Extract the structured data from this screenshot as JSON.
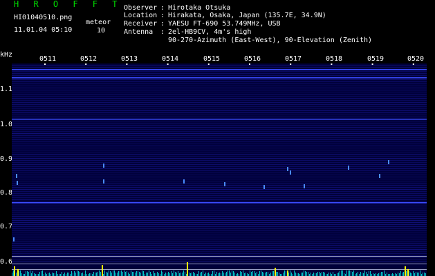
{
  "header": {
    "app_title": "H R O F F T",
    "file_name": "HI01040510.png",
    "time_stamp": "11.01.04 05:10",
    "meteor_label": "meteor",
    "meteor_count": "10"
  },
  "info": [
    {
      "key": "Observer",
      "value": "Hirotaka Otsuka"
    },
    {
      "key": "Location",
      "value": "Hirakata, Osaka, Japan (135.7E, 34.9N)"
    },
    {
      "key": "Receiver",
      "value": "YAESU FT-690 53.749MHz, USB"
    },
    {
      "key": "Antenna",
      "value": "2el-HB9CV, 4m's high"
    },
    {
      "key": "",
      "value": "90-270-Azimuth (East-West), 90-Elevation (Zenith)"
    }
  ],
  "separator": ":",
  "spectrogram": {
    "y_unit_label": "kHz",
    "y_ticks": [
      "1.1",
      "1.0",
      "0.9",
      "0.8",
      "0.7",
      "0.6"
    ],
    "x_ticks": [
      "0511",
      "0512",
      "0513",
      "0514",
      "0515",
      "0516",
      "0517",
      "0518",
      "0519",
      "0520"
    ],
    "colors": {
      "background": "#00003a",
      "noise": "#1a1aa0",
      "carrier_line": "#3a4cff",
      "echo": "#4a8cff",
      "bottom_trace": "#00c8c8",
      "spike": "#ffff00"
    }
  }
}
